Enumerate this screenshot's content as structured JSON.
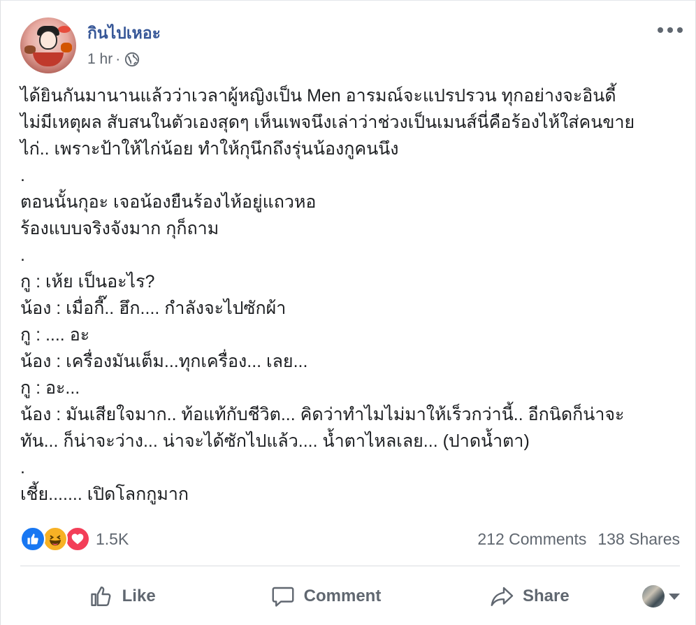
{
  "post": {
    "page_name": "กินไปเหอะ",
    "time": "1 hr",
    "separator": "·",
    "privacy_icon": "globe-icon",
    "body_lines": [
      "ได้ยินกันมานานแล้วว่าเวลาผู้หญิงเป็น Men อารมณ์จะแปรปรวน ทุกอย่างจะอินดี้",
      "ไม่มีเหตุผล สับสนในตัวเองสุดๆ เห็นเพจนึงเล่าว่าช่วงเป็นเมนส์นี่คือร้องไห้ใส่คนขาย",
      "ไก่.. เพราะป้าให้ไก่น้อย ทำให้กุนึกถึงรุ่นน้องกูคนนึง",
      ".",
      "ตอนนั้นกุอะ เจอน้องยืนร้องไห้อยู่แถวหอ",
      "ร้องแบบจริงจังมาก กุก็ถาม",
      ".",
      "กู : เห้ย เป็นอะไร?",
      "น้อง : เมื่อกี๊.. ฮึก.... กำลังจะไปซักผ้า",
      "กู : .... อะ",
      "น้อง : เครื่องมันเต็ม...ทุกเครื่อง... เลย...",
      "กู : อะ...",
      "น้อง : มันเสียใจมาก.. ท้อแท้กับชีวิต... คิดว่าทำไมไม่มาให้เร็วกว่านี้.. อีกนิดก็น่าจะ",
      "ทัน... ก็น่าจะว่าง... น่าจะได้ซักไปแล้ว.... น้ำตาไหลเลย... (ปาดน้ำตา)",
      ".",
      "เชี้ย....... เปิดโลกกูมาก"
    ]
  },
  "stats": {
    "reaction_count": "1.5K",
    "comments": "212 Comments",
    "shares": "138 Shares",
    "reaction_icons": [
      "like-icon",
      "haha-icon",
      "love-icon"
    ]
  },
  "actions": {
    "like": "Like",
    "comment": "Comment",
    "share": "Share"
  },
  "colors": {
    "page_name": "#385898",
    "secondary_text": "#606770",
    "like_blue": "#1877f2",
    "haha_yellow": "#f7b125",
    "love_red": "#f33e58"
  }
}
